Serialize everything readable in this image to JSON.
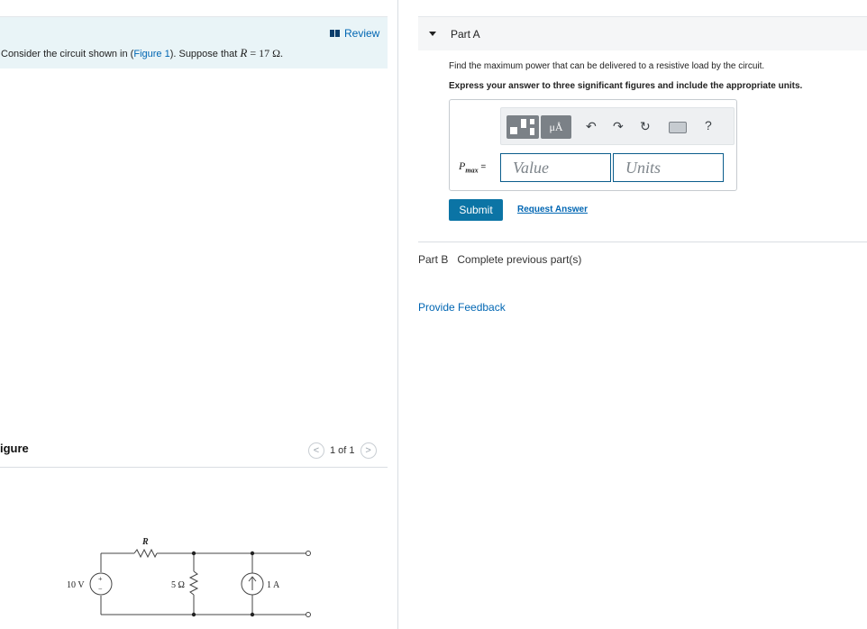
{
  "problem": {
    "review_label": "Review",
    "text_before": "Consider the circuit shown in (",
    "figure_link": "Figure 1",
    "text_after": "). Suppose that ",
    "variable": "R",
    "equals": " = 17 Ω."
  },
  "figure": {
    "heading": "igure",
    "pager_text": "1 of 1",
    "prev_icon": "chevron-left-icon",
    "next_icon": "chevron-right-icon",
    "circuit": {
      "source_label": "10 V",
      "resistor_top_label": "R",
      "resistor_mid_label": "5 Ω",
      "current_label": "1 A",
      "plus": "+",
      "minus": "−"
    }
  },
  "part_a": {
    "title": "Part A",
    "instruction": "Find the maximum power that can be delivered to a resistive load by the circuit.",
    "instruction_bold": "Express your answer to three significant figures and include the appropriate units.",
    "units_button": "μÅ",
    "answer_label": "P",
    "answer_sub": "max",
    "answer_eq": " =",
    "value_placeholder": "Value",
    "units_placeholder": "Units",
    "submit_label": "Submit",
    "request_label": "Request Answer",
    "help": "?"
  },
  "part_b": {
    "label": "Part B",
    "status": "Complete previous part(s)"
  },
  "feedback_label": "Provide Feedback"
}
